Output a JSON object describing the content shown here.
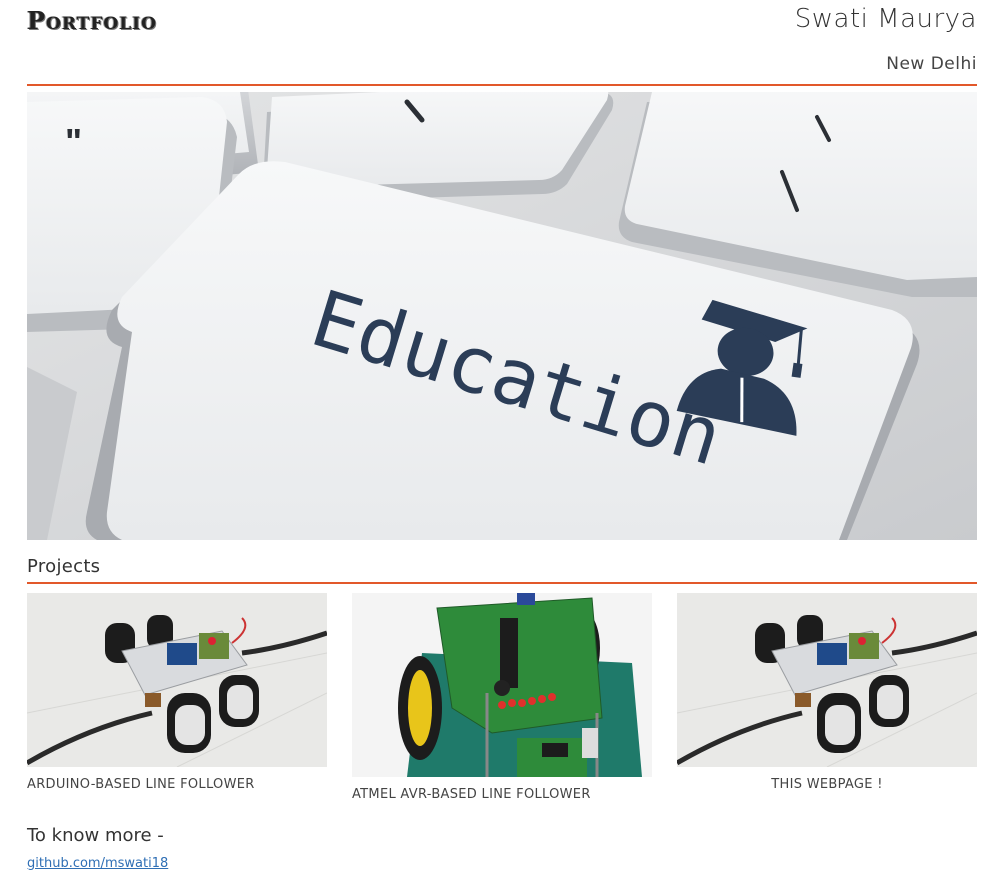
{
  "header": {
    "brand": "Portfolio",
    "name": "Swati Maurya",
    "location": "New Delhi"
  },
  "hero": {
    "key_label": "Education",
    "icon": "graduate-icon"
  },
  "projects": {
    "heading": "Projects",
    "items": [
      {
        "caption": "Arduino-based line follower",
        "image": "robot-car-photo"
      },
      {
        "caption": "Atmel AVR-based line follower",
        "image": "avr-board-photo"
      },
      {
        "caption": "This webpage !",
        "image": "robot-car-photo"
      }
    ]
  },
  "footer": {
    "know_more": "To know more -",
    "link": "github.com/mswati18"
  },
  "colors": {
    "accent_line": "#e2582a",
    "link": "#2f6fb5",
    "hero_text": "#2b3d57"
  }
}
